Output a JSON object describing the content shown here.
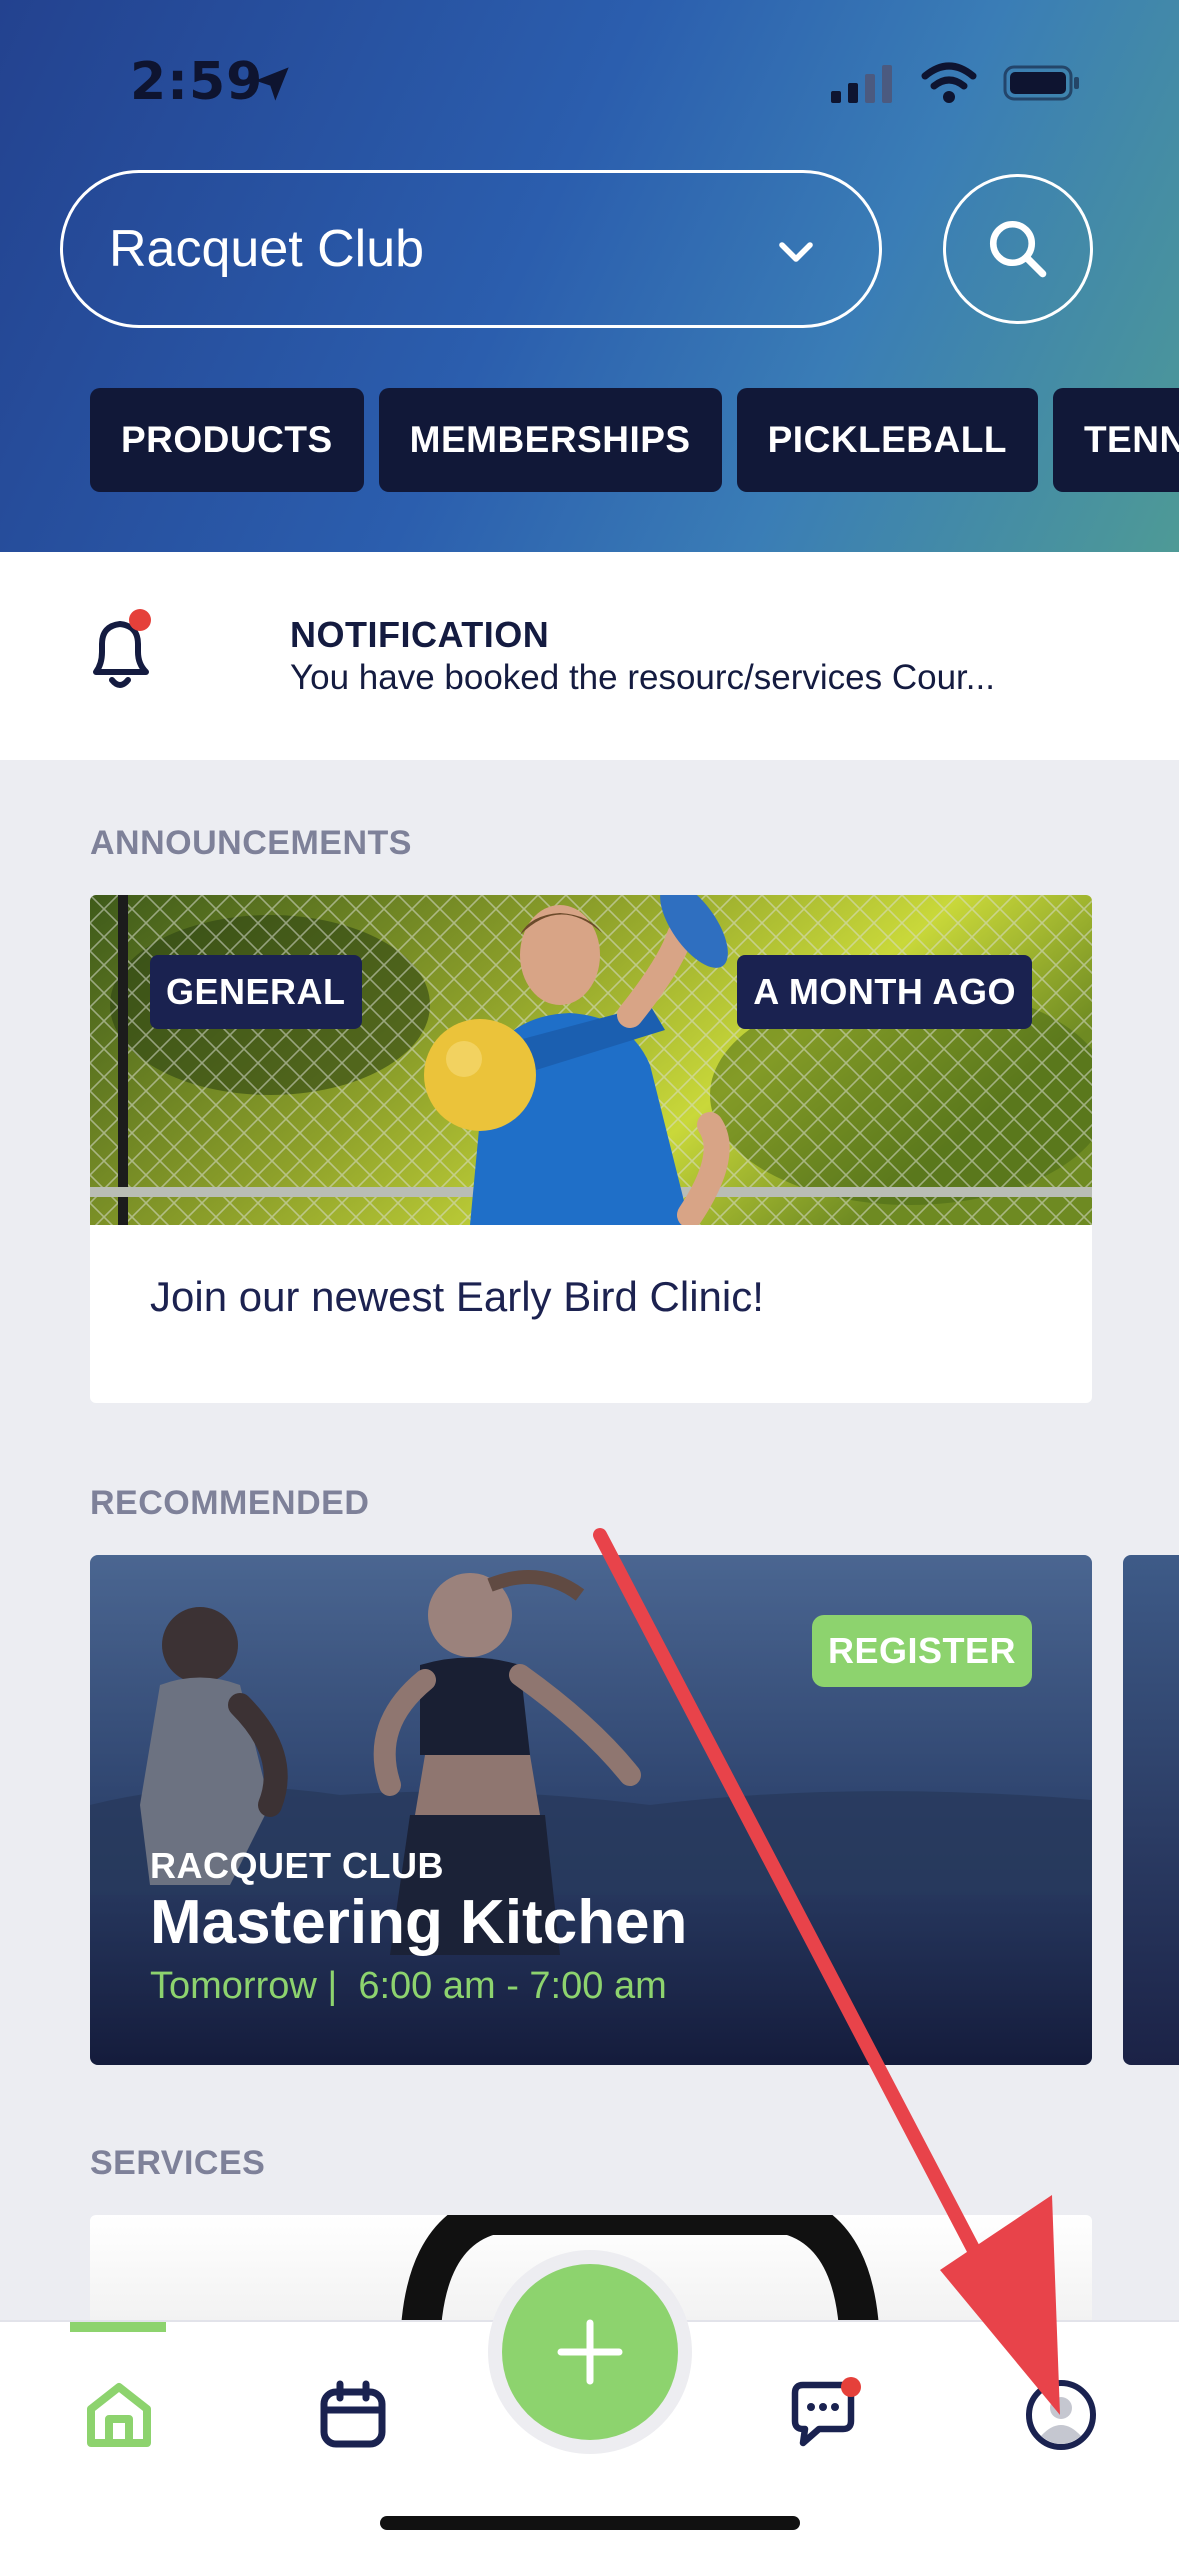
{
  "status_bar": {
    "time": "2:59"
  },
  "header": {
    "club_select_value": "Racquet Club",
    "tabs": [
      "PRODUCTS",
      "MEMBERSHIPS",
      "PICKLEBALL",
      "TENN"
    ]
  },
  "notification": {
    "title": "NOTIFICATION",
    "text": "You have booked the resourc/services Cour..."
  },
  "announcements": {
    "section_label": "ANNOUNCEMENTS",
    "card": {
      "category": "GENERAL",
      "time_ago": "A MONTH AGO",
      "text": "Join our newest Early Bird Clinic!"
    }
  },
  "recommended": {
    "section_label": "RECOMMENDED",
    "card": {
      "action": "REGISTER",
      "club": "RACQUET CLUB",
      "title": "Mastering Kitchen",
      "time": "Tomorrow |  6:00 am - 7:00 am"
    }
  },
  "services": {
    "section_label": "SERVICES"
  },
  "bottom_nav": {
    "items": [
      "home-icon",
      "calendar-icon",
      "add-icon",
      "chat-icon",
      "profile-icon"
    ],
    "active": "home-icon"
  },
  "colors": {
    "accent_green": "#8DD36E",
    "navy": "#111838",
    "notification_dot": "#E5403A",
    "annotation_arrow": "#E8434A"
  }
}
